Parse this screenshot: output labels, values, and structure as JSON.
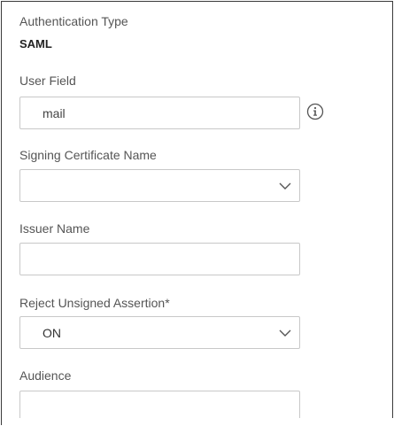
{
  "auth": {
    "label": "Authentication Type",
    "value": "SAML"
  },
  "user_field": {
    "label": "User Field",
    "value": "mail",
    "info_icon": "info-circle-icon"
  },
  "signing_certificate": {
    "label": "Signing Certificate Name",
    "selected": "",
    "icon": "chevron-down-icon"
  },
  "issuer_name": {
    "label": "Issuer Name",
    "value": ""
  },
  "reject_unsigned": {
    "label": "Reject Unsigned Assertion*",
    "selected": "ON",
    "icon": "chevron-down-icon"
  },
  "audience": {
    "label": "Audience",
    "value": ""
  },
  "colors": {
    "border": "#c8c8c8",
    "label": "#555555",
    "text": "#333333"
  }
}
